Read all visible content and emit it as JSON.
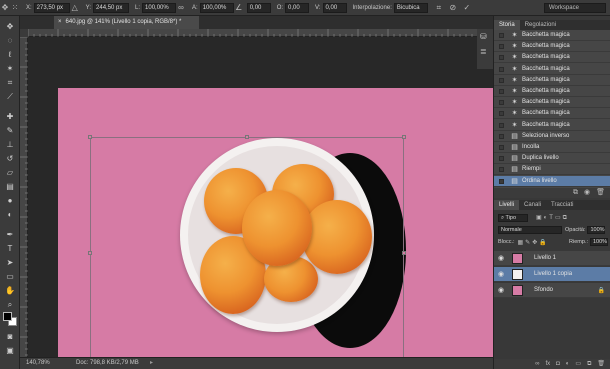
{
  "options": {
    "x_label": "X:",
    "x_value": "273,50 px",
    "y_label": "Y:",
    "y_value": "244,50 px",
    "w_label": "L:",
    "w_value": "100,00%",
    "h_label": "A:",
    "h_value": "100,00%",
    "angle_value": "0,00",
    "hskew_label": "O:",
    "hskew_value": "0,00",
    "vskew_label": "V:",
    "vskew_value": "0,00",
    "interp_label": "Interpolazione:",
    "interp_value": "Bicubica"
  },
  "workspace": "Workspace",
  "document": {
    "tab_title": "640.jpg @ 141% (Livello 1 copia, RGB/8*) *"
  },
  "status": {
    "zoom": "140,78%",
    "doc": "Doc: 798,8 KB/2,79 MB"
  },
  "history": {
    "tabs": [
      "Storia",
      "Regolazioni"
    ],
    "items": [
      {
        "label": "Bacchetta magica",
        "icon": "magic-wand-icon",
        "selected": false
      },
      {
        "label": "Bacchetta magica",
        "icon": "magic-wand-icon",
        "selected": false
      },
      {
        "label": "Bacchetta magica",
        "icon": "magic-wand-icon",
        "selected": false
      },
      {
        "label": "Bacchetta magica",
        "icon": "magic-wand-icon",
        "selected": false
      },
      {
        "label": "Bacchetta magica",
        "icon": "magic-wand-icon",
        "selected": false
      },
      {
        "label": "Bacchetta magica",
        "icon": "magic-wand-icon",
        "selected": false
      },
      {
        "label": "Bacchetta magica",
        "icon": "magic-wand-icon",
        "selected": false
      },
      {
        "label": "Bacchetta magica",
        "icon": "magic-wand-icon",
        "selected": false
      },
      {
        "label": "Bacchetta magica",
        "icon": "magic-wand-icon",
        "selected": false
      },
      {
        "label": "Seleziona inverso",
        "icon": "document-icon",
        "selected": false
      },
      {
        "label": "Incolla",
        "icon": "document-icon",
        "selected": false
      },
      {
        "label": "Duplica livello",
        "icon": "document-icon",
        "selected": false
      },
      {
        "label": "Riempi",
        "icon": "document-icon",
        "selected": false
      },
      {
        "label": "Ordina livello",
        "icon": "document-icon",
        "selected": true
      }
    ]
  },
  "layers": {
    "tabs": [
      "Livelli",
      "Canali",
      "Tracciati"
    ],
    "kind_filter": "Tipo",
    "blend_mode": "Normale",
    "opacity_label": "Opacità:",
    "opacity_value": "100%",
    "lock_label": "Blocc.:",
    "fill_label": "Riemp.:",
    "fill_value": "100%",
    "items": [
      {
        "name": "Livello 1",
        "selected": false,
        "locked": false,
        "thumb": "#d67ba5"
      },
      {
        "name": "Livello 1 copia",
        "selected": true,
        "locked": false,
        "thumb": "#f4f1f0"
      },
      {
        "name": "Sfondo",
        "selected": false,
        "locked": true,
        "thumb": "#d67ba5"
      }
    ]
  },
  "colors": {
    "canvas_bg": "#d67ba5",
    "selection": "#5c7ca6",
    "apricot": "#ee9230"
  }
}
